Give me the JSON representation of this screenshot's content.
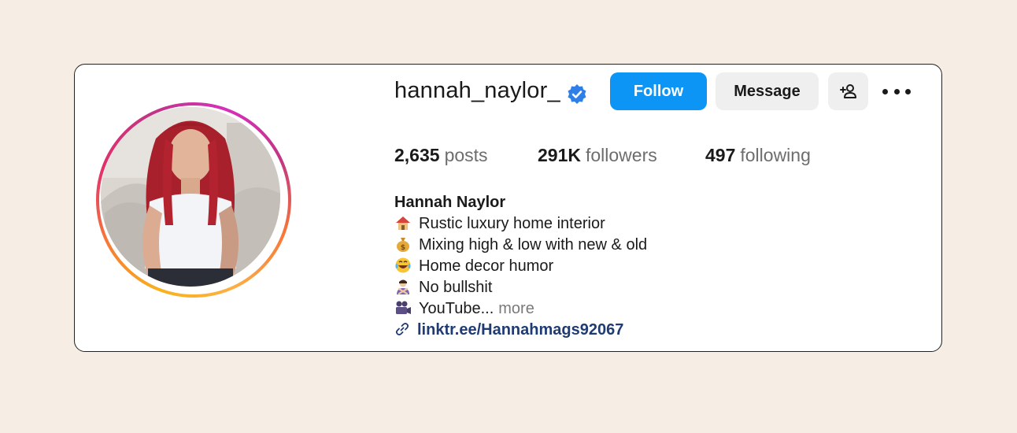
{
  "profile": {
    "username": "hannah_naylor_",
    "verified": true,
    "display_name": "Hannah Naylor",
    "avatar_icon": "profile-photo"
  },
  "actions": {
    "follow_label": "Follow",
    "message_label": "Message",
    "suggest_icon": "add-person-icon",
    "more_icon": "more-options-icon"
  },
  "stats": {
    "posts_count": "2,635",
    "posts_label": "posts",
    "followers_count": "291K",
    "followers_label": "followers",
    "following_count": "497",
    "following_label": "following"
  },
  "bio": {
    "lines": [
      {
        "emoji": "house-emoji",
        "text": "Rustic luxury home interior"
      },
      {
        "emoji": "money-bag-emoji",
        "text": "Mixing high & low with new & old"
      },
      {
        "emoji": "laughing-emoji",
        "text": "Home decor humor"
      },
      {
        "emoji": "person-gesturing-no-emoji",
        "text": "No bullshit"
      },
      {
        "emoji": "movie-camera-emoji",
        "text": "YouTube..."
      }
    ],
    "more_label": "more",
    "link_text": "linktr.ee/Hannahmags92067"
  },
  "colors": {
    "background": "#f6eee4",
    "follow_button": "#0d95f6",
    "secondary_button": "#efefef",
    "verified_badge": "#2f7fe8",
    "link_text": "#1f3b73"
  }
}
